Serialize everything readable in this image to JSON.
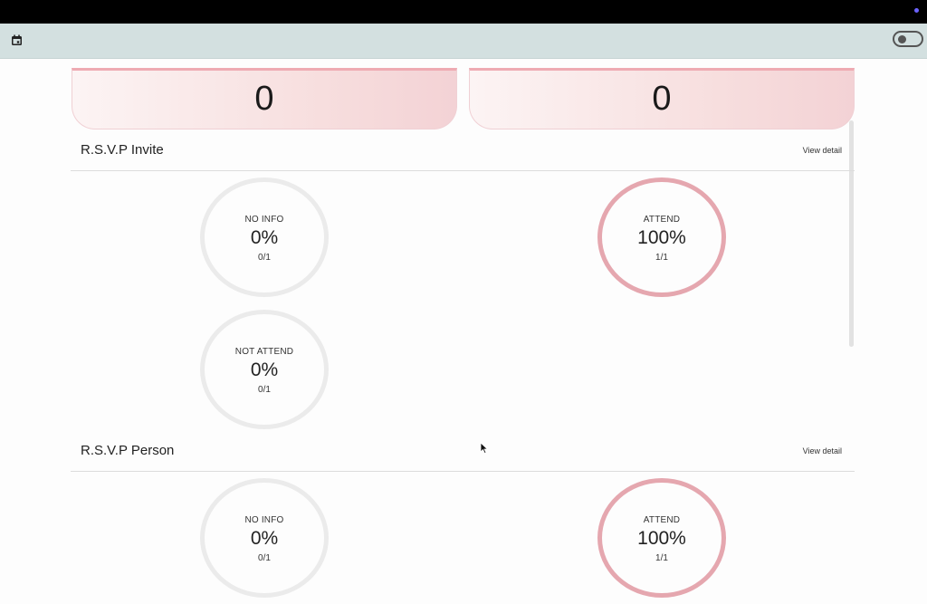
{
  "icons": {
    "calendar": "calendar-icon",
    "theme_toggle": "toggle-switch-off",
    "cursor": "mouse-pointer"
  },
  "colors": {
    "top_bar": "#000000",
    "app_bar": "#d3e0e0",
    "card_accent": "#eeaab2",
    "ring_active": "#e5a7af",
    "ring_inactive": "#ebebeb"
  },
  "stats": [
    {
      "value": "0"
    },
    {
      "value": "0"
    }
  ],
  "rsvp_invite": {
    "title": "R.S.V.P Invite",
    "view_label": "View detail",
    "items": [
      {
        "label": "NO INFO",
        "percent": "0%",
        "fraction": "0/1",
        "state": "inactive"
      },
      {
        "label": "ATTEND",
        "percent": "100%",
        "fraction": "1/1",
        "state": "active"
      },
      {
        "label": "NOT ATTEND",
        "percent": "0%",
        "fraction": "0/1",
        "state": "inactive"
      }
    ]
  },
  "rsvp_person": {
    "title": "R.S.V.P Person",
    "view_label": "View detail",
    "items": [
      {
        "label": "NO INFO",
        "percent": "0%",
        "fraction": "0/1",
        "state": "inactive"
      },
      {
        "label": "ATTEND",
        "percent": "100%",
        "fraction": "1/1",
        "state": "active"
      }
    ]
  }
}
